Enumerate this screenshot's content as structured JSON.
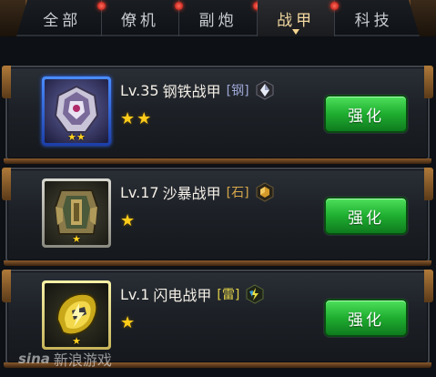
{
  "tabs": [
    {
      "label": "全部",
      "active": false
    },
    {
      "label": "僚机",
      "active": false
    },
    {
      "label": "副炮",
      "active": false
    },
    {
      "label": "战甲",
      "active": true
    },
    {
      "label": "科技",
      "active": false
    }
  ],
  "items": [
    {
      "level": "Lv.35",
      "name": "钢铁战甲",
      "material": "[钢]",
      "stars": "★★",
      "rarity_color": "#2f6aff",
      "action_label": "强化",
      "icon": "steel-armor-icon",
      "badge_icon": "steel-gem-icon"
    },
    {
      "level": "Lv.17",
      "name": "沙暴战甲",
      "material": "[石]",
      "stars": "★",
      "rarity_color": "#b8b8b0",
      "action_label": "强化",
      "icon": "sandstorm-armor-icon",
      "badge_icon": "stone-gem-icon"
    },
    {
      "level": "Lv.1",
      "name": "闪电战甲",
      "material": "[雷]",
      "stars": "★",
      "rarity_color": "#e8e08a",
      "action_label": "强化",
      "icon": "lightning-armor-icon",
      "badge_icon": "thunder-gem-icon"
    }
  ],
  "watermark": {
    "logo": "sina",
    "text": "新浪游戏"
  },
  "colors": {
    "button_green": "#1fae30",
    "accent_gold": "#f2d9a0",
    "star": "#ffcc1a"
  }
}
